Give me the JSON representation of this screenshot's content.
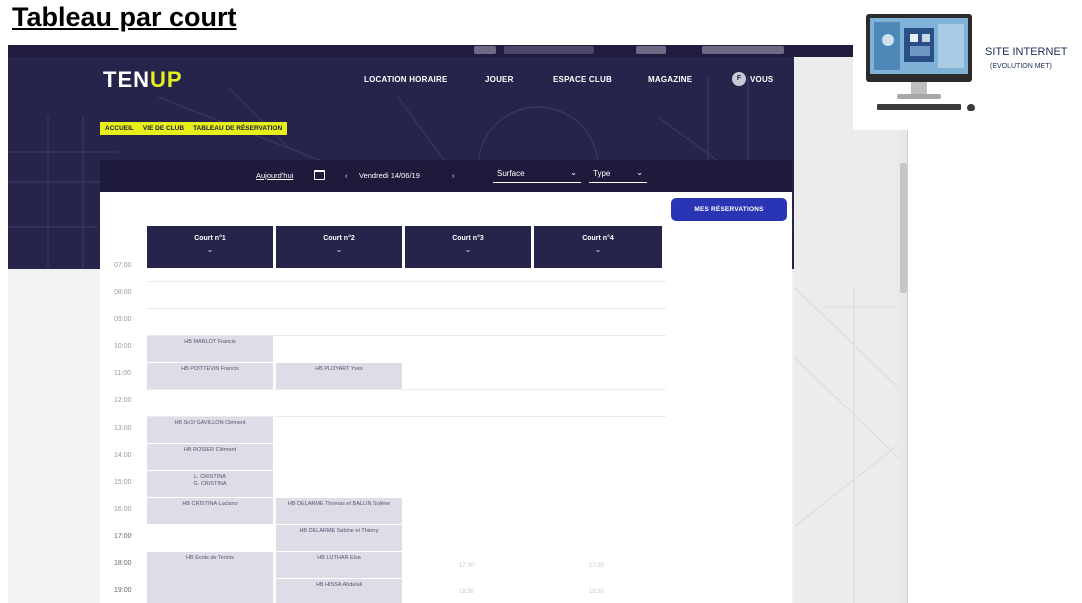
{
  "slide": {
    "title": "Tableau par court"
  },
  "app": {
    "logo_left": "TEN",
    "logo_right": "UP",
    "nav": [
      {
        "label": "LOCATION HORAIRE"
      },
      {
        "label": "JOUER"
      },
      {
        "label": "ESPACE CLUB"
      },
      {
        "label": "MAGAZINE"
      },
      {
        "label": "VOUS"
      }
    ],
    "avatar_letter": "F",
    "breadcrumb": [
      {
        "label": "ACCUEIL"
      },
      {
        "label": "VIE DE CLUB"
      },
      {
        "label": "TABLEAU DE RÉSERVATION"
      }
    ],
    "filters": {
      "today": "Aujourd'hui",
      "prev": "‹",
      "date": "Vendredi 14/06/19",
      "next": "›",
      "surface": "Surface",
      "type": "Type"
    },
    "my_reservations": "MES RÉSERVATIONS",
    "courts": [
      {
        "label": "Court n°1"
      },
      {
        "label": "Court n°2"
      },
      {
        "label": "Court n°3"
      },
      {
        "label": "Court n°4"
      }
    ],
    "times": [
      "07:00",
      "08:00",
      "09:00",
      "10:00",
      "11:00",
      "12:00",
      "13:00",
      "14:00",
      "15:00",
      "16:00",
      "17:00",
      "18:00",
      "19:00"
    ],
    "bookings": {
      "c1_10": "HB MARLOT Francis",
      "c1_11": "HB POITTEVIN Francis",
      "c1_13": "HB Sn1f GAVILLON Clément",
      "c1_14": "HB ROSIER Clément",
      "c1_15a": "L. CRISTINA",
      "c1_15b": "G. CRISTINA",
      "c1_16": "HB CRISTINA Luciano",
      "c1_18": "HB Ecole de Tennis",
      "c2_11": "HB PLOYART Yves",
      "c2_16": "HB DELARME Thomas et BALLIN Solène",
      "c2_17": "HB DELARME Sabine et Thierry",
      "c2_18": "HB LUTHAR Elsa",
      "c2_19": "HB HISSA Abdelali"
    },
    "ghost_times": {
      "c3_18": "17:30",
      "c4_18": "17:30",
      "c3_19": "18:30",
      "c4_19": "18:30"
    }
  },
  "badge": {
    "title": "SITE INTERNET",
    "subtitle": "(EVOLUTION MET)"
  }
}
